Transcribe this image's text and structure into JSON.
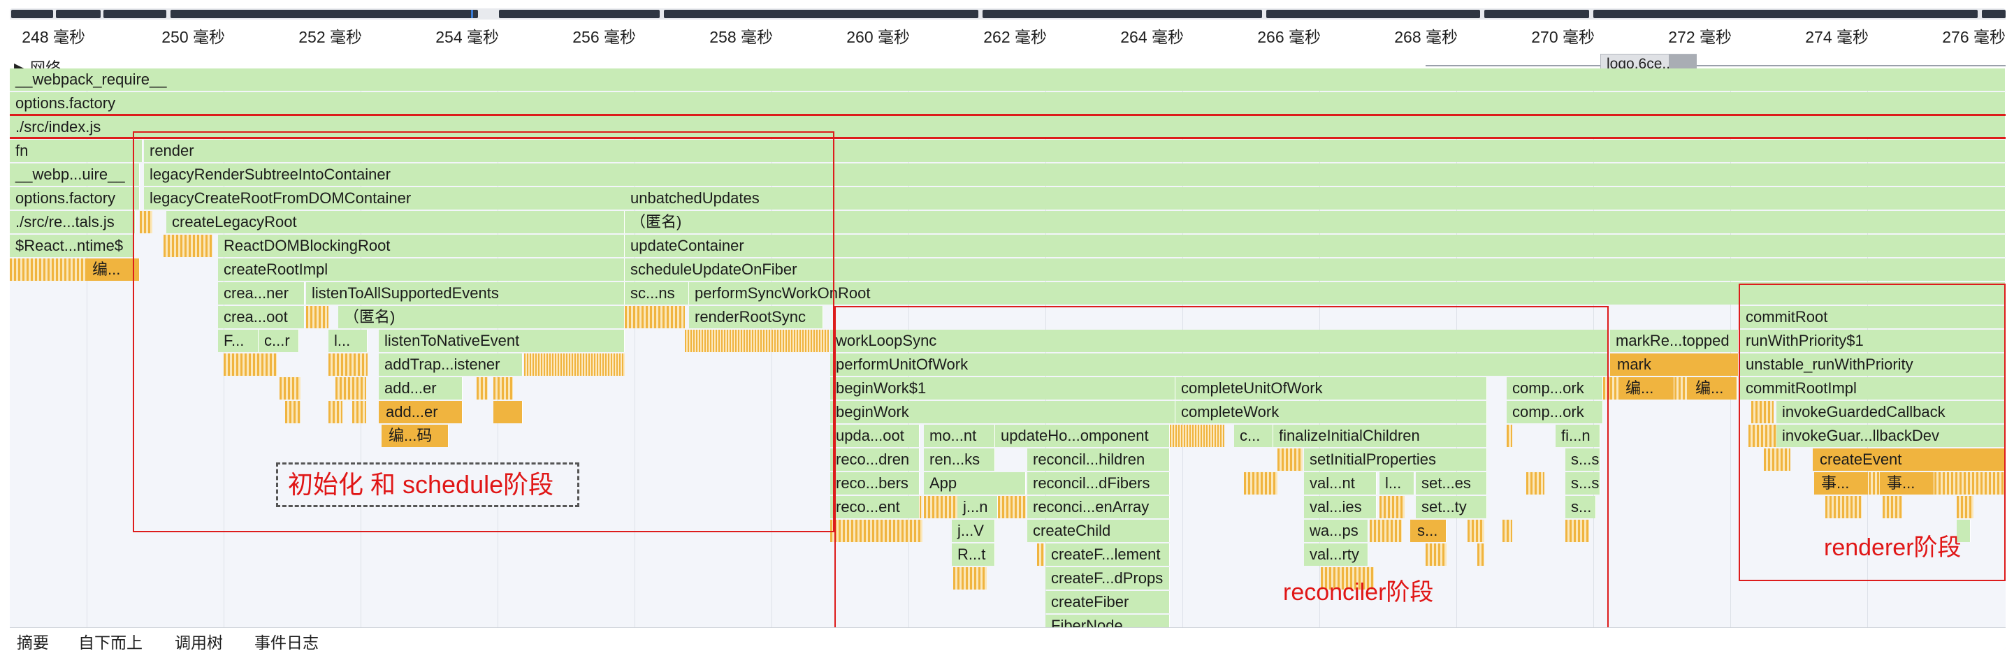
{
  "ruler": {
    "ticks": [
      "248 毫秒",
      "250 毫秒",
      "252 毫秒",
      "254 毫秒",
      "256 毫秒",
      "258 毫秒",
      "260 毫秒",
      "262 毫秒",
      "264 毫秒",
      "266 毫秒",
      "268 毫秒",
      "270 毫秒",
      "272 毫秒",
      "274 毫秒",
      "276 毫秒"
    ]
  },
  "network": {
    "label": "▶ 网络",
    "item": "logo.6ce..."
  },
  "flame": {
    "webpack_require": "__webpack_require__",
    "options_factory": "options.factory",
    "src_index": "./src/index.js",
    "fn": "fn",
    "webp_uire": "__webp...uire__",
    "options_factory2": "options.factory",
    "src_re_tals": "./src/re...tals.js",
    "react_ntime": "$React...ntime$",
    "bian": "编...",
    "render": "render",
    "legacy_render_subtree": "legacyRenderSubtreeIntoContainer",
    "legacy_create_root_dom": "legacyCreateRootFromDOMContainer",
    "unbatched_updates": "unbatchedUpdates",
    "create_legacy_root": "createLegacyRoot",
    "anonymous": "（匿名)",
    "react_dom_blocking_root": "ReactDOMBlockingRoot",
    "update_container": "updateContainer",
    "create_root_impl": "createRootImpl",
    "schedule_update_on_fiber": "scheduleUpdateOnFiber",
    "crea_ner": "crea...ner",
    "listen_to_all": "listenToAllSupportedEvents",
    "sc_ns": "sc...ns",
    "perform_sync_work": "performSyncWorkOnRoot",
    "crea_oot": "crea...oot",
    "anonymous2": "（匿名)",
    "render_root_sync": "renderRootSync",
    "f_dots": "F...",
    "c_r": "c...r",
    "l_dots": "l...",
    "listen_to_native": "listenToNativeEvent",
    "add_trap": "addTrap...istener",
    "add_er1": "add...er",
    "add_er2": "add...er",
    "bian_ma": "编...码",
    "work_loop_sync": "workLoopSync",
    "perform_unit": "performUnitOfWork",
    "begin_work_1": "beginWork$1",
    "complete_unit": "completeUnitOfWork",
    "comp_ork1": "comp...ork",
    "begin_work": "beginWork",
    "complete_work": "completeWork",
    "comp_ork2": "comp...ork",
    "upda_oot": "upda...oot",
    "mo_nt": "mo...nt",
    "update_ho_omponent": "updateHo...omponent",
    "c_dots": "c...",
    "finalize_initial": "finalizeInitialChildren",
    "fi_n": "fi...n",
    "reco_dren": "reco...dren",
    "ren_ks": "ren...ks",
    "reconcil_hildren": "reconcil...hildren",
    "set_initial_props": "setInitialProperties",
    "s_s1": "s...s",
    "reco_bers": "reco...bers",
    "app": "App",
    "reconcil_dfibers": "reconcil...dFibers",
    "val_nt": "val...nt",
    "l_dots2": "l...",
    "set_es": "set...es",
    "s_s2": "s...s",
    "reco_ent": "reco...ent",
    "j_n": "j...n",
    "reconci_enarray": "reconci...enArray",
    "val_ies": "val...ies",
    "set_ty": "set...ty",
    "s_dots": "s...",
    "j_v": "j...V",
    "create_child": "createChild",
    "wa_ps": "wa...ps",
    "s_dots2": "s...",
    "r_t": "R...t",
    "create_f_lement": "createF...lement",
    "val_rty": "val...rty",
    "create_f_dprops": "createF...dProps",
    "create_fiber": "createFiber",
    "fiber_node": "FiberNode",
    "mark_re_topped": "markRe...topped",
    "mark": "mark",
    "bian2": "编...",
    "bian3": "编...",
    "commit_root": "commitRoot",
    "run_with_priority": "runWithPriority$1",
    "unstable_run": "unstable_runWithPriority",
    "commit_root_impl": "commitRootImpl",
    "invoke_guarded": "invokeGuardedCallback",
    "invoke_guar_dev": "invokeGuar...llbackDev",
    "create_event": "createEvent",
    "shi1": "事...",
    "shi2": "事..."
  },
  "annotations": {
    "init_schedule": "初始化 和  schedule阶段",
    "reconciler": "reconciler阶段",
    "renderer": "renderer阶段"
  },
  "bottom_tabs": [
    "摘要",
    "自下而上",
    "调用树",
    "事件日志"
  ],
  "colors": {
    "script": "#c8ebb6",
    "gc": "#f0b43f",
    "annotation": "#e01616",
    "background": "#f3f5fa"
  }
}
